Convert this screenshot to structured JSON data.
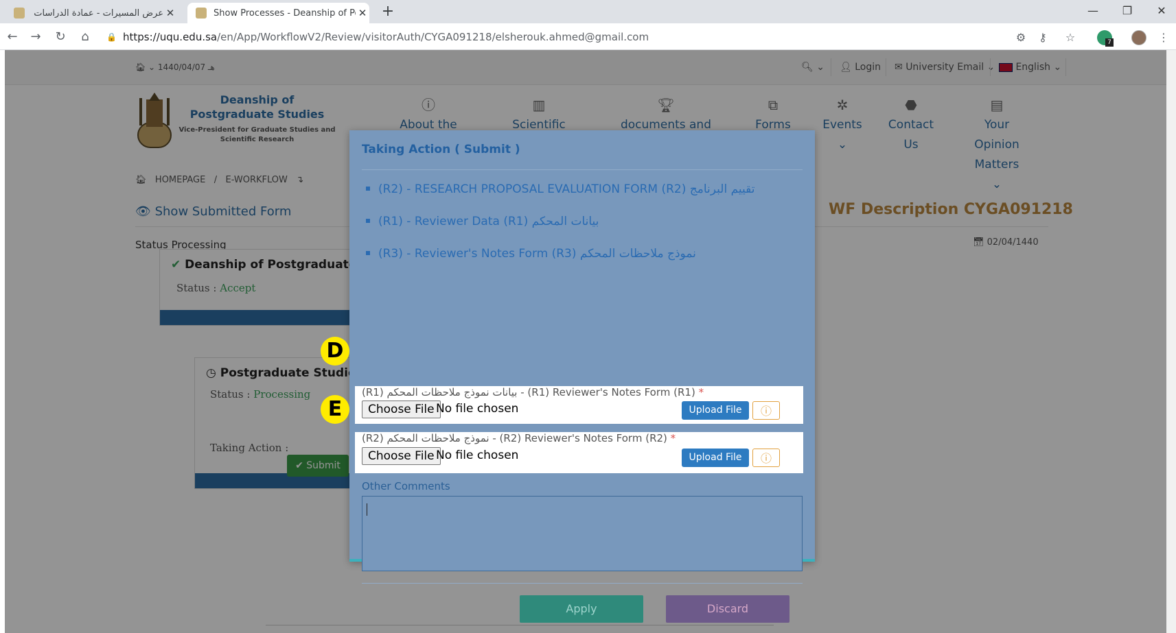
{
  "browser": {
    "tabs": [
      {
        "title": "عرض المسيرات - عمادة الدراسات ال",
        "active": false
      },
      {
        "title": "Show Processes - Deanship of Po",
        "active": true
      }
    ],
    "new_tab": "+",
    "url_host": "https://uqu.edu.sa",
    "url_path": "/en/App/WorkflowV2/Review/visitorAuth/CYGA091218/elsherouk.ahmed@gmail.com",
    "extension_badge": "7"
  },
  "topbar": {
    "date": "1440/04/07 هـ",
    "login": "Login",
    "university_email": "University Email",
    "language": "English"
  },
  "site": {
    "title": "Deanship of Postgraduate Studies",
    "subtitle": "Vice-President for Graduate Studies and Scientific Research",
    "menu": [
      {
        "icon": "info-icon",
        "label": "About the"
      },
      {
        "icon": "book-icon",
        "label": "Scientific"
      },
      {
        "icon": "trophy-icon",
        "label": "documents and"
      },
      {
        "icon": "forms-icon",
        "label": "Forms"
      },
      {
        "icon": "events-icon",
        "label": "Events"
      },
      {
        "icon": "android-icon",
        "label": "Contact Us"
      },
      {
        "icon": "opinion-icon",
        "label": "Your Opinion Matters"
      }
    ]
  },
  "breadcrumb": {
    "home": "HOMEPAGE",
    "sep": "/",
    "current": "E-WORKFLOW"
  },
  "main": {
    "show_form": "Show Submitted Form",
    "wf_description": "WF Description CYGA091218",
    "status_processing": "Status Processing",
    "date": "02/04/1440",
    "cards": [
      {
        "title": "Deanship of Postgraduate S",
        "status_label": "Status :",
        "status": "Accept"
      },
      {
        "title": "Postgraduate Studies",
        "status_label": "Status :",
        "status": "Processing",
        "action_label": "Taking Action :",
        "action_button": "Submit"
      }
    ]
  },
  "annotations": {
    "d": "D",
    "e": "E"
  },
  "modal": {
    "title": "Taking Action ( Submit )",
    "forms": [
      "(R2) - RESEARCH PROPOSAL EVALUATION FORM (R2) تقييم البرنامج",
      "(R1) - Reviewer Data (R1) بيانات المحكم",
      "(R3) - Reviewer's Notes Form (R3) نموذج ملاحظات المحكم"
    ],
    "uploads": [
      {
        "label": "(R1) بيانات نموذج ملاحظات المحكم - (R1) Reviewer's Notes Form (R1)",
        "required": "*",
        "choose": "Choose File",
        "no_file": "No file chosen",
        "upload": "Upload File"
      },
      {
        "label": "(R2) نموذج ملاحظات المحكم - (R2) Reviewer's Notes Form (R2)",
        "required": "*",
        "choose": "Choose File",
        "no_file": "No file chosen",
        "upload": "Upload File"
      }
    ],
    "comments_label": "Other Comments",
    "comments_value": "",
    "apply": "Apply",
    "discard": "Discard"
  }
}
